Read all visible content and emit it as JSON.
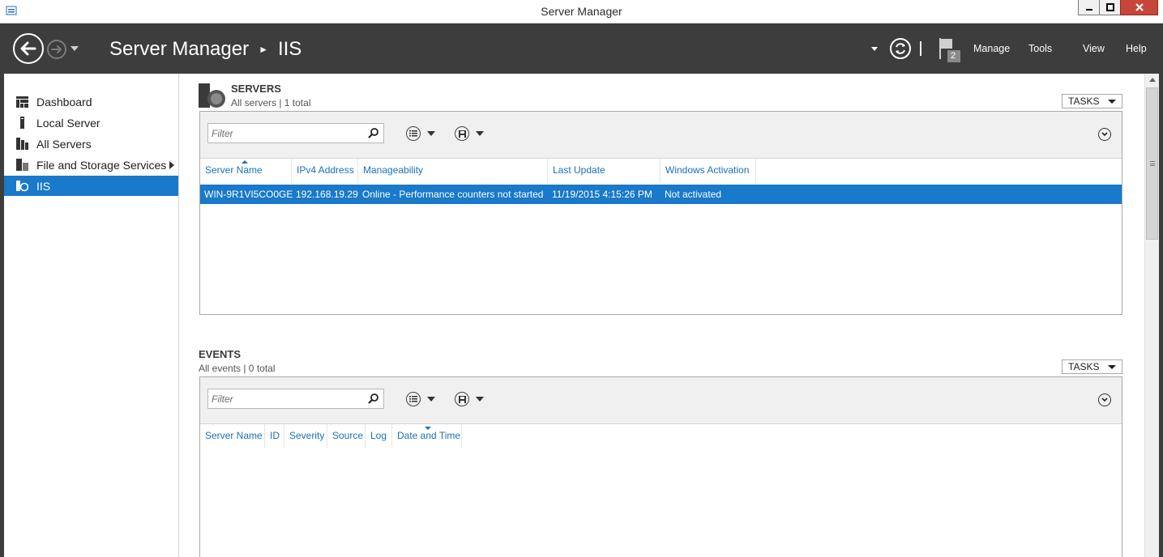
{
  "window": {
    "title": "Server Manager"
  },
  "header": {
    "breadcrumb_root": "Server Manager",
    "breadcrumb_current": "IIS",
    "notification_count": "2",
    "menu": {
      "manage": "Manage",
      "tools": "Tools",
      "view": "View",
      "help": "Help"
    }
  },
  "sidebar": {
    "items": [
      {
        "label": "Dashboard"
      },
      {
        "label": "Local Server"
      },
      {
        "label": "All Servers"
      },
      {
        "label": "File and Storage Services"
      },
      {
        "label": "IIS"
      }
    ]
  },
  "servers": {
    "title": "SERVERS",
    "subtitle": "All servers | 1 total",
    "tasks_label": "TASKS",
    "filter_placeholder": "Filter",
    "columns": [
      "Server Name",
      "IPv4 Address",
      "Manageability",
      "Last Update",
      "Windows Activation"
    ],
    "rows": [
      {
        "server_name": "WIN-9R1VI5CO0GE",
        "ipv4": "192.168.19.29",
        "manageability": "Online - Performance counters not started",
        "last_update": "11/19/2015 4:15:26 PM",
        "activation": "Not activated"
      }
    ]
  },
  "events": {
    "title": "EVENTS",
    "subtitle": "All events | 0 total",
    "tasks_label": "TASKS",
    "filter_placeholder": "Filter",
    "columns": [
      "Server Name",
      "ID",
      "Severity",
      "Source",
      "Log",
      "Date and Time"
    ]
  },
  "colors": {
    "header_bg": "#3d3d3d",
    "selection": "#1979ca",
    "column_link": "#1a72b6",
    "toolbar_bg": "#f0f0f0"
  },
  "icons": [
    "app-icon",
    "back-arrow-icon",
    "forward-arrow-icon",
    "refresh-icon",
    "flag-icon",
    "dashboard-icon",
    "local-server-icon",
    "all-servers-icon",
    "file-storage-icon",
    "iis-icon",
    "servers-section-icon",
    "search-icon",
    "list-options-icon",
    "save-query-icon",
    "collapse-icon"
  ]
}
